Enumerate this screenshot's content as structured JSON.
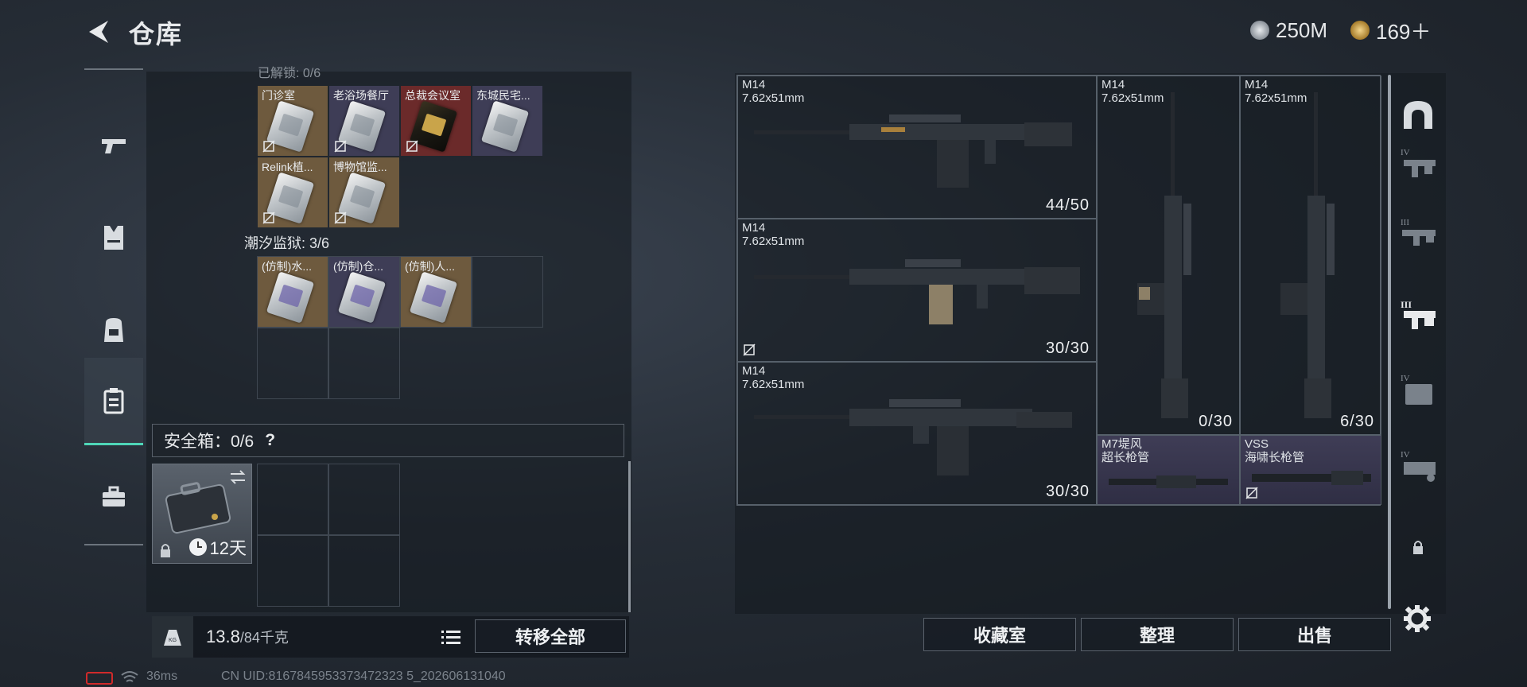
{
  "header": {
    "title": "仓库",
    "currency1": "250M",
    "currency2": "169＋",
    "currency1_icon": "silver-coin-icon",
    "currency2_icon": "gold-coin-icon"
  },
  "left_categories": [
    {
      "name": "weapons-category",
      "icon": "pistol-icon"
    },
    {
      "name": "armor-category",
      "icon": "vest-icon"
    },
    {
      "name": "backpack-category",
      "icon": "backpack-icon"
    },
    {
      "name": "keycard-category",
      "icon": "keycard-case-icon",
      "active": true
    },
    {
      "name": "toolbox-category",
      "icon": "toolbox-icon"
    }
  ],
  "stash": {
    "top_header_partial": "已解锁: 0/6",
    "group1": [
      {
        "label": "门诊室",
        "style": "silver"
      },
      {
        "label": "老浴场餐厅",
        "style": "silver"
      },
      {
        "label": "总裁会议室",
        "style": "gold"
      },
      {
        "label": "东城民宅...",
        "style": "silver"
      },
      {
        "label": "Relink植...",
        "style": "silver"
      },
      {
        "label": "博物馆监...",
        "style": "silver"
      }
    ],
    "section2_label": "潮汐监狱: 3/6",
    "group2": [
      {
        "label": "(仿制)水...",
        "style": "purple"
      },
      {
        "label": "(仿制)仓...",
        "style": "purple"
      },
      {
        "label": "(仿制)人...",
        "style": "purple"
      }
    ]
  },
  "safebox": {
    "label": "安全箱：0/6",
    "help": "?",
    "days": "12天"
  },
  "weight": {
    "current": "13.8",
    "capacity": "/84千克"
  },
  "buttons": {
    "transfer_all": "转移全部",
    "collection": "收藏室",
    "sort": "整理",
    "sell": "出售"
  },
  "warehouse": {
    "items": [
      {
        "name": "M14\n7.62x51mm",
        "ammo": "44/50"
      },
      {
        "name": "M14\n7.62x51mm",
        "ammo": "30/30"
      },
      {
        "name": "M14\n7.62x51mm",
        "ammo": "30/30"
      },
      {
        "name": "M14\n7.62x51mm",
        "ammo": "0/30"
      },
      {
        "name": "M14\n7.62x51mm",
        "ammo": "6/30"
      },
      {
        "name": "M7堤风\n超长枪管",
        "ammo": ""
      },
      {
        "name": "VSS\n海啸长枪管",
        "ammo": ""
      }
    ]
  },
  "right_categories": [
    {
      "name": "all-category",
      "icon": "helmet-arch-icon"
    },
    {
      "name": "tier4-gun-category",
      "icon": "tier4-rifle-icon",
      "tier": "IV"
    },
    {
      "name": "tier3-gun-category",
      "icon": "tier3-rifle-icon",
      "tier": "III"
    },
    {
      "name": "tier3-mod-category",
      "icon": "tier3-mod-icon",
      "tier": "III"
    },
    {
      "name": "tier4-bag-category",
      "icon": "tier4-bag-icon",
      "tier": "IV"
    },
    {
      "name": "tier4-armor-category",
      "icon": "tier4-armor-icon",
      "tier": "IV"
    },
    {
      "name": "locked-category",
      "icon": "lock-icon"
    }
  ],
  "status": {
    "ping": "36ms",
    "uid": "CN UID:8167845953373472323 5_202606131040"
  }
}
